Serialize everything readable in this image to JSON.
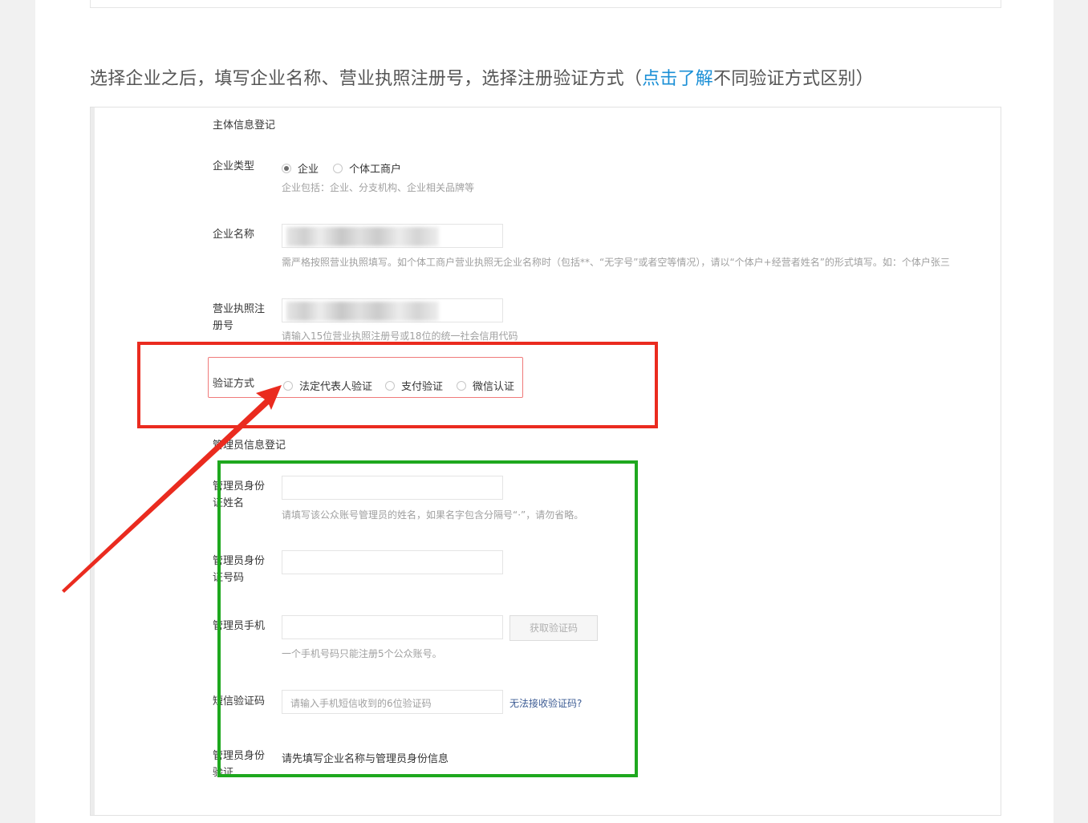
{
  "intro": {
    "before": "选择企业之后，填写企业名称、营业执照注册号，选择注册验证方式（",
    "link": "点击了解",
    "after": "不同验证方式区别）"
  },
  "form": {
    "subject_section_title": "主体信息登记",
    "enterprise_type": {
      "label": "企业类型",
      "options": [
        "企业",
        "个体工商户"
      ],
      "selected": "企业",
      "hint": "企业包括：企业、分支机构、企业相关品牌等"
    },
    "enterprise_name": {
      "label": "企业名称",
      "hint": "需严格按照营业执照填写。如个体工商户营业执照无企业名称时（包括**、“无字号”或者空等情况），请以“个体户+经营者姓名”的形式填写。如：个体户张三"
    },
    "license_number": {
      "label_line1": "营业执照注",
      "label_line2": "册号",
      "hint": "请输入15位营业执照注册号或18位的统一社会信用代码"
    },
    "verify_method": {
      "label": "验证方式",
      "options": [
        "法定代表人验证",
        "支付验证",
        "微信认证"
      ]
    },
    "admin_section_title": "管理员信息登记",
    "admin_name": {
      "label_line1": "管理员身份",
      "label_line2": "证姓名",
      "hint": "请填写该公众账号管理员的姓名，如果名字包含分隔号“·”，请勿省略。"
    },
    "admin_id": {
      "label_line1": "管理员身份",
      "label_line2": "证号码"
    },
    "admin_phone": {
      "label": "管理员手机",
      "get_code_button": "获取验证码",
      "hint": "一个手机号码只能注册5个公众账号。"
    },
    "sms_code": {
      "label": "短信验证码",
      "placeholder": "请输入手机短信收到的6位验证码",
      "cant_receive_link": "无法接收验证码?"
    },
    "admin_verify": {
      "label_line1": "管理员身份",
      "label_line2": "验证",
      "value": "请先填写企业名称与管理员身份信息"
    }
  },
  "annotations": {
    "red_box_color": "#ea2b1f",
    "green_box_color": "#1ea81e",
    "arrow_color": "#ea2b1f"
  }
}
